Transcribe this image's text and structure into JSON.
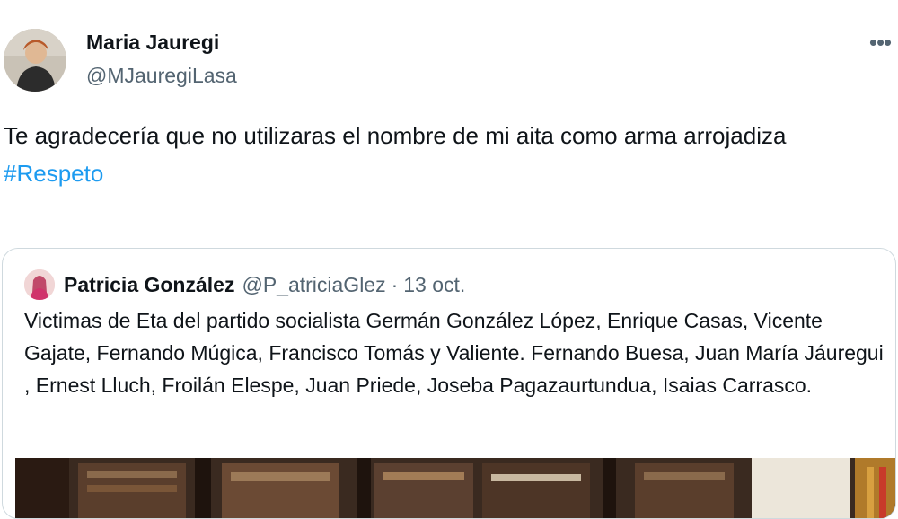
{
  "tweet": {
    "author_name": "Maria Jauregi",
    "author_handle": "@MJauregiLasa",
    "more_icon": "more-horizontal-icon",
    "text": "Te agradecería que no utilizaras el nombre de mi aita como arma arrojadiza",
    "hashtag": "#Respeto",
    "hashtag_color": "#1d9bf0"
  },
  "quote": {
    "author_name": "Patricia González",
    "author_handle": "@P_atriciaGlez",
    "separator": "·",
    "date": "13 oct.",
    "text": "Victimas de Eta del partido socialista Germán González López, Enrique Casas, Vicente Gajate, Fernando Múgica, Francisco Tomás y Valiente. Fernando Buesa, Juan María Jáuregui , Ernest Lluch, Froilán Elespe, Juan Priede, Joseba Pagazaurtundua, Isaias Carrasco."
  }
}
